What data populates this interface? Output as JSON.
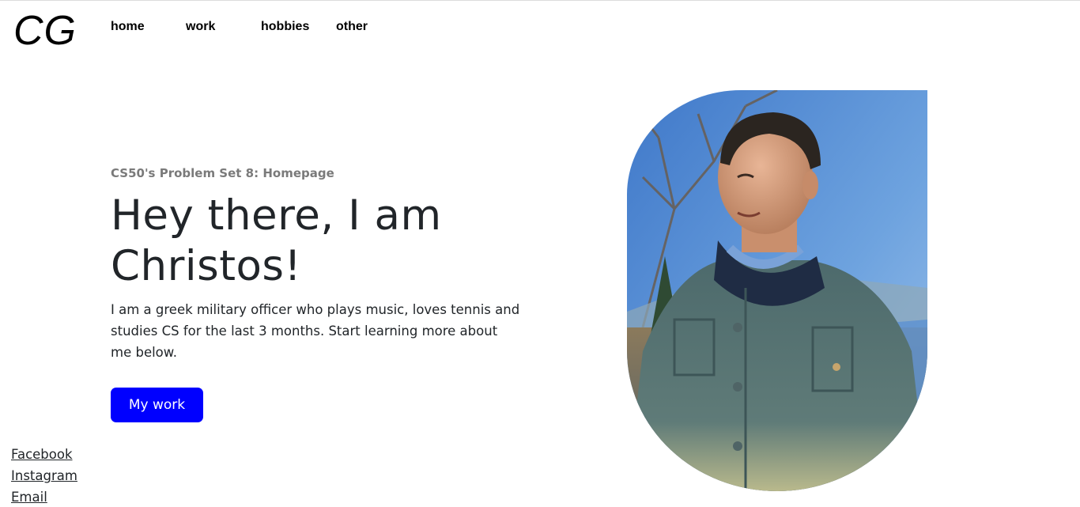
{
  "nav": {
    "logo": "CG",
    "items": [
      {
        "label": "home"
      },
      {
        "label": "work"
      },
      {
        "label": "hobbies"
      },
      {
        "label": "other"
      }
    ]
  },
  "hero": {
    "subtitle": "CS50's Problem Set 8: Homepage",
    "headline": "Hey there, I am Christos!",
    "intro": "I am a greek military officer who plays music, loves tennis and studies CS for the last 3 months. Start learning more about me below.",
    "button_label": "My work"
  },
  "social": {
    "links": [
      {
        "label": "Facebook"
      },
      {
        "label": "Instagram"
      },
      {
        "label": "Email"
      }
    ]
  },
  "colors": {
    "accent": "#0000ff",
    "text": "#212529",
    "muted": "#7a7a7a"
  }
}
